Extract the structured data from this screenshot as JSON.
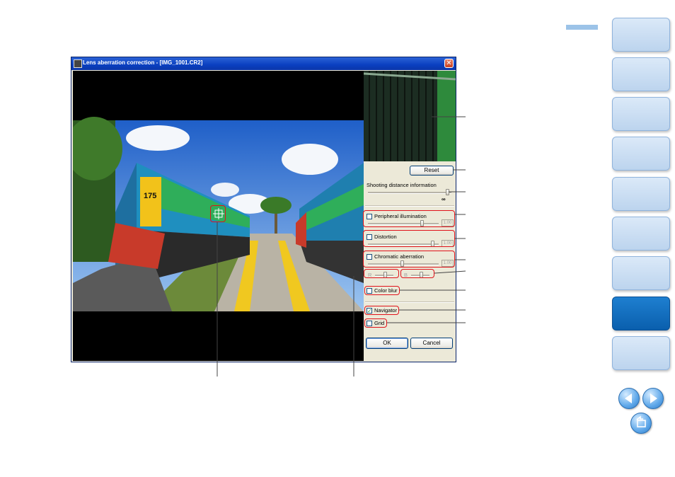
{
  "dialog": {
    "title": "Lens aberration correction - [IMG_1001.CR2]",
    "close_glyph": "✕",
    "buttons": {
      "reset": "Reset",
      "ok": "OK",
      "cancel": "Cancel"
    },
    "shooting_distance": {
      "label": "Shooting distance information",
      "value_symbol": "∞"
    },
    "peripheral_illumination": {
      "label": "Peripheral illumination",
      "value": "1.00",
      "checked": false
    },
    "distortion": {
      "label": "Distortion",
      "value": "1.00",
      "checked": false
    },
    "chromatic_aberration": {
      "label": "Chromatic aberration",
      "value": "1.00",
      "checked": false,
      "r_label": "R",
      "b_label": "B"
    },
    "color_blur": {
      "label": "Color blur",
      "checked": false
    },
    "navigator": {
      "label": "Navigator",
      "checked": true
    },
    "grid": {
      "label": "Grid",
      "checked": false
    },
    "check_glyph": "✓",
    "preview": {
      "locomotive_number": "175"
    }
  },
  "colors": {
    "highlight": "#e0121b",
    "titlebar": "#0a3fc0",
    "active_tab": "#0a5fad",
    "tab": "#bcd4ee"
  },
  "icons": {
    "prev": "prev-page-icon",
    "next": "next-page-icon",
    "back": "back-icon",
    "cursor": "crosshair-cursor-icon"
  }
}
